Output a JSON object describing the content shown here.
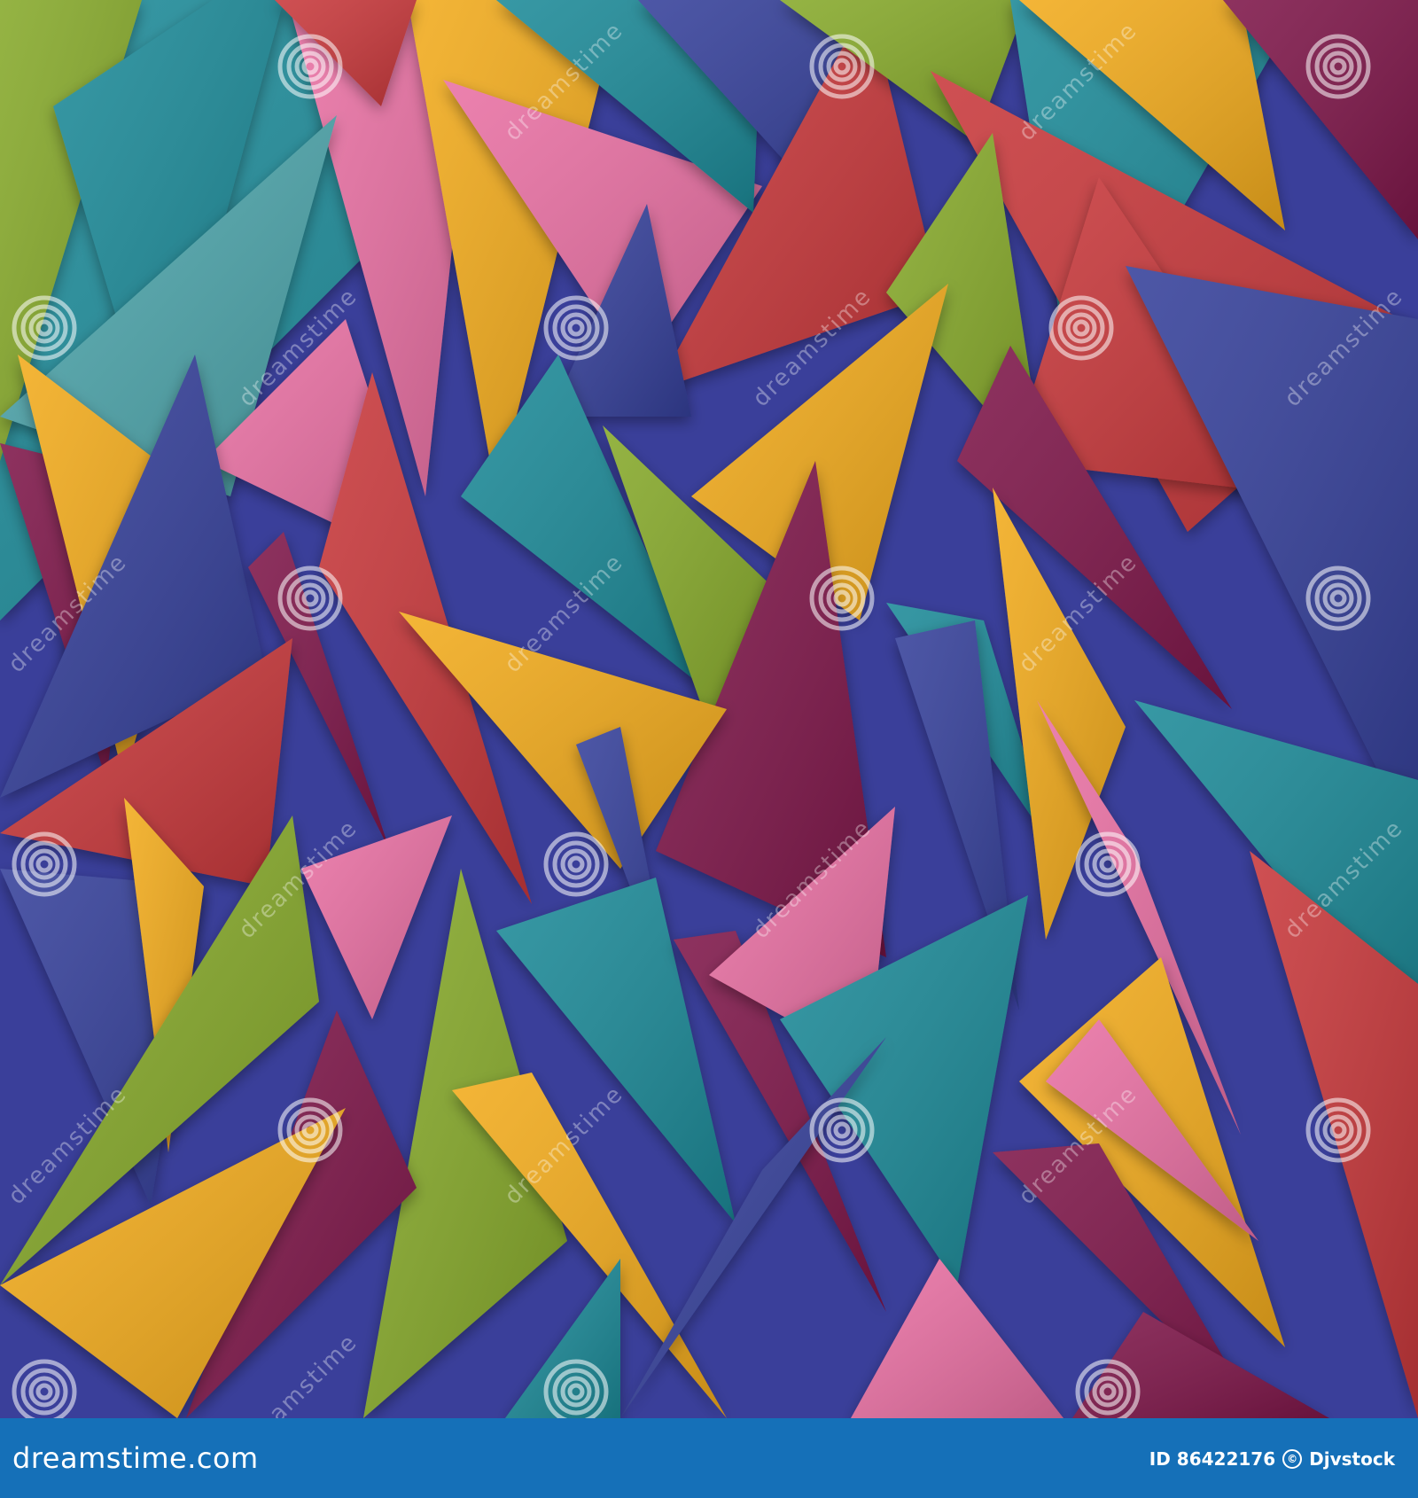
{
  "artwork": {
    "palette": {
      "green": "#86a92b",
      "teal": "#1f8a98",
      "pink": "#e96fa3",
      "yellow": "#f2ab1e",
      "red": "#c8383b",
      "blue": "#343f9a",
      "magenta": "#7e1248",
      "lightTeal": "#4fa7ad",
      "footerBlue": "#1570b8"
    },
    "watermark_text": "dreamstime",
    "watermark_icon": "dreamstime-spiral-icon"
  },
  "footer": {
    "brand": "dreamstime.com",
    "id_label": "ID 86422176",
    "copyright_icon": "copyright-icon",
    "author": "Djvstock"
  }
}
